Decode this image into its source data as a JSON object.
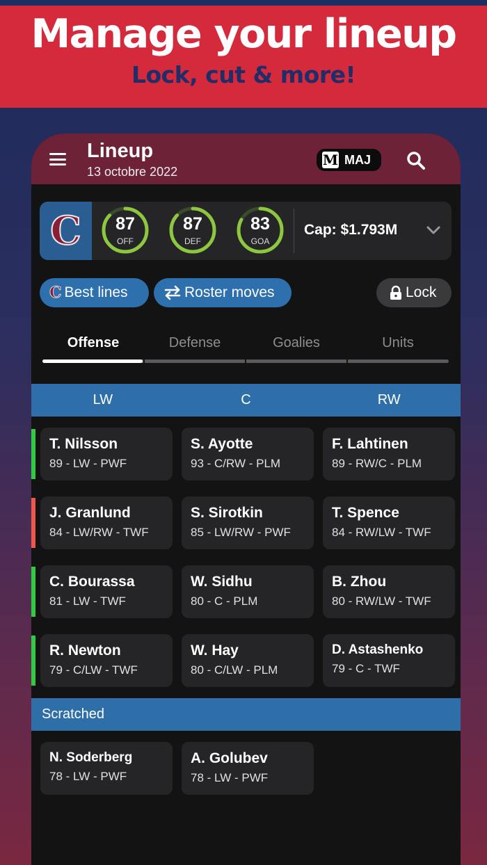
{
  "promo": {
    "title": "Manage your lineup",
    "subtitle": "Lock, cut & more!"
  },
  "appbar": {
    "title": "Lineup",
    "date": "13 octobre 2022",
    "league_logo": "M",
    "league": "MAJ"
  },
  "team": {
    "logo_letter": "C",
    "ratings": [
      {
        "value": "87",
        "label": "OFF",
        "fill": 0.87
      },
      {
        "value": "87",
        "label": "DEF",
        "fill": 0.87
      },
      {
        "value": "83",
        "label": "GOA",
        "fill": 0.83
      }
    ],
    "cap": "Cap: $1.793M"
  },
  "actions": {
    "best_lines": "Best lines",
    "roster_moves": "Roster moves",
    "lock": "Lock"
  },
  "tabs": [
    "Offense",
    "Defense",
    "Goalies",
    "Units"
  ],
  "positions": [
    "LW",
    "C",
    "RW"
  ],
  "lines": [
    {
      "status_color": "#2ecc40",
      "players": [
        {
          "name": "T. Nilsson",
          "info": "89 - LW - PWF"
        },
        {
          "name": "S. Ayotte",
          "info": "93 - C/RW - PLM"
        },
        {
          "name": "F. Lahtinen",
          "info": "89 - RW/C - PLM"
        }
      ]
    },
    {
      "status_color": "#f0564a",
      "players": [
        {
          "name": "J. Granlund",
          "info": "84 - LW/RW - TWF"
        },
        {
          "name": "S. Sirotkin",
          "info": "85 - LW/RW - PWF"
        },
        {
          "name": "T. Spence",
          "info": "84 - RW/LW - TWF"
        }
      ]
    },
    {
      "status_color": "#2ecc40",
      "players": [
        {
          "name": "C. Bourassa",
          "info": "81 - LW - TWF"
        },
        {
          "name": "W. Sidhu",
          "info": "80 - C - PLM"
        },
        {
          "name": "B. Zhou",
          "info": "80 - RW/LW - TWF"
        }
      ]
    },
    {
      "status_color": "#2ecc40",
      "players": [
        {
          "name": "R. Newton",
          "info": "79 - C/LW - TWF"
        },
        {
          "name": "W. Hay",
          "info": "80 - C/LW - PLM"
        },
        {
          "name": "D. Astashenko",
          "info": "79 - C - TWF"
        }
      ]
    }
  ],
  "scratched": {
    "label": "Scratched",
    "players": [
      {
        "name": "N. Soderberg",
        "info": "78 - LW - PWF"
      },
      {
        "name": "A. Golubev",
        "info": "78 - LW - PWF"
      }
    ]
  },
  "colors": {
    "banner": "#d42a3c",
    "appbar": "#6e2238",
    "accent_blue": "#2e6fa9",
    "gauge_green": "#8dc63f"
  }
}
